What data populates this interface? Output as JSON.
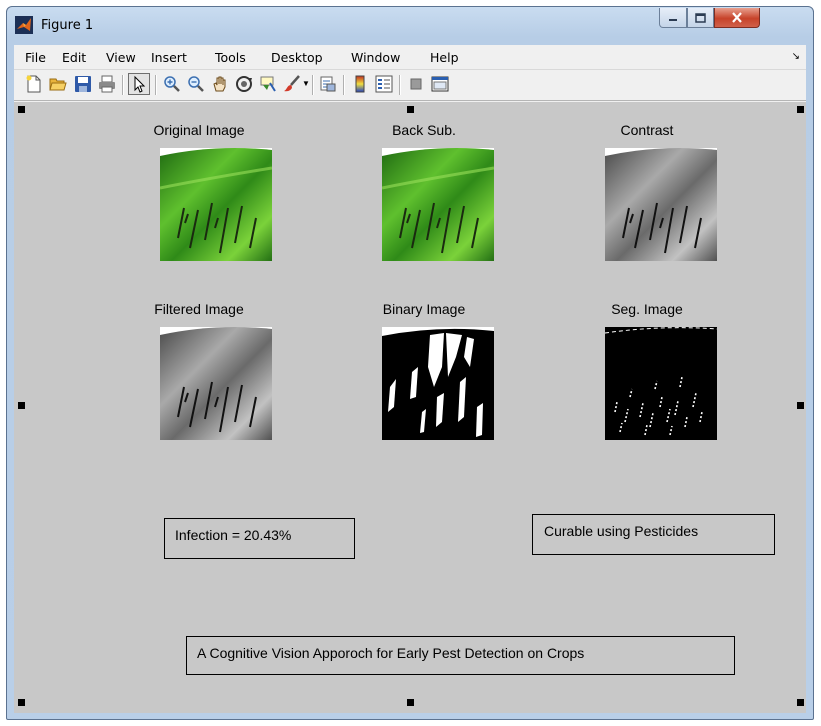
{
  "window": {
    "title": "Figure 1"
  },
  "menu": [
    "File",
    "Edit",
    "View",
    "Insert",
    "Tools",
    "Desktop",
    "Window",
    "Help"
  ],
  "toolbar": {
    "icons": [
      "new-figure-icon",
      "open-file-icon",
      "save-icon",
      "print-icon",
      "select-arrow-icon",
      "zoom-in-icon",
      "zoom-out-icon",
      "pan-hand-icon",
      "rotate-3d-icon",
      "data-cursor-icon",
      "brush-icon",
      "link-plot-icon",
      "colorbar-icon",
      "legend-icon",
      "hide-plot-tools-icon",
      "show-plot-tools-icon"
    ]
  },
  "panels": {
    "original": "Original Image",
    "backsub": "Back Sub.",
    "contrast": "Contrast",
    "filtered": "Filtered Image",
    "binary": "Binary Image",
    "seg": "Seg. Image"
  },
  "results": {
    "infection": "Infection = 20.43%",
    "status": "Curable using Pesticides",
    "caption": "A Cognitive Vision Apporoch for Early Pest Detection on Crops"
  },
  "colors": {
    "figure_bg": "#c8c8c8",
    "leaf_green": "#3f9b1f",
    "close_red": "#c7432a"
  }
}
